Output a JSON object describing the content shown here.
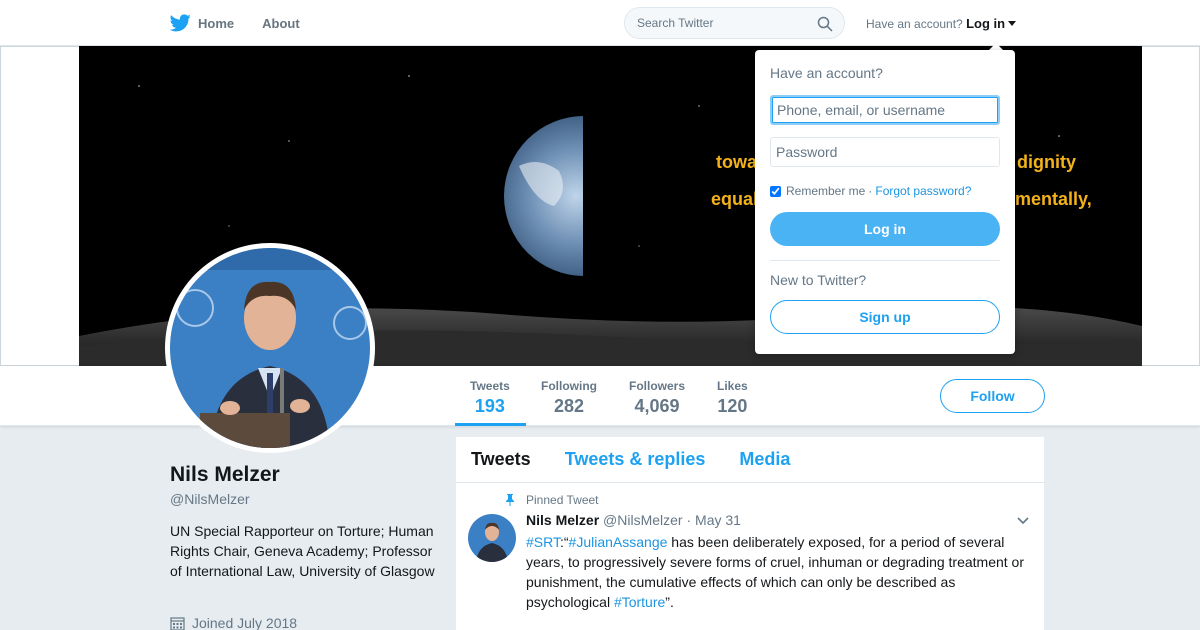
{
  "colors": {
    "accent": "#1da1f2",
    "background": "#e6ecf0",
    "banner_text": "#f3b21b"
  },
  "nav": {
    "logo_icon": "twitter-bird-icon",
    "home_label": "Home",
    "about_label": "About",
    "search_placeholder": "Search Twitter",
    "search_icon": "search-icon",
    "account_prompt": "Have an account?",
    "login_label": "Log in"
  },
  "banner": {
    "line1_left": "towa",
    "line1_right": "dignity",
    "line2_left": "equal",
    "line2_right": "mentally,"
  },
  "stats": [
    {
      "label": "Tweets",
      "value": "193"
    },
    {
      "label": "Following",
      "value": "282"
    },
    {
      "label": "Followers",
      "value": "4,069"
    },
    {
      "label": "Likes",
      "value": "120"
    }
  ],
  "follow_label": "Follow",
  "profile": {
    "name": "Nils Melzer",
    "handle": "@NilsMelzer",
    "bio": "UN Special Rapporteur on Torture; Human Rights Chair, Geneva Academy; Professor of International Law, University of Glasgow",
    "joined": "Joined July 2018"
  },
  "timeline": {
    "tabs": [
      "Tweets",
      "Tweets & replies",
      "Media"
    ],
    "pinned_label": "Pinned Tweet",
    "tweet": {
      "name": "Nils Melzer",
      "handle": "@NilsMelzer",
      "separator": "·",
      "date": "May 31",
      "hashtag1": "#SRT",
      "text1": ":“",
      "hashtag2": "#JulianAssange",
      "text2": " has been deliberately exposed, for a period of several years, to progressively severe forms of cruel, inhuman or degrading treatment or punishment, the cumulative effects of which can only be described as psychological ",
      "hashtag3": "#Torture",
      "text3": "”."
    }
  },
  "login_dropdown": {
    "title": "Have an account?",
    "username_placeholder": "Phone, email, or username",
    "password_placeholder": "Password",
    "remember_label": "Remember me",
    "separator": "·",
    "forgot_label": "Forgot password?",
    "login_button": "Log in",
    "new_prompt": "New to Twitter?",
    "signup_button": "Sign up"
  }
}
